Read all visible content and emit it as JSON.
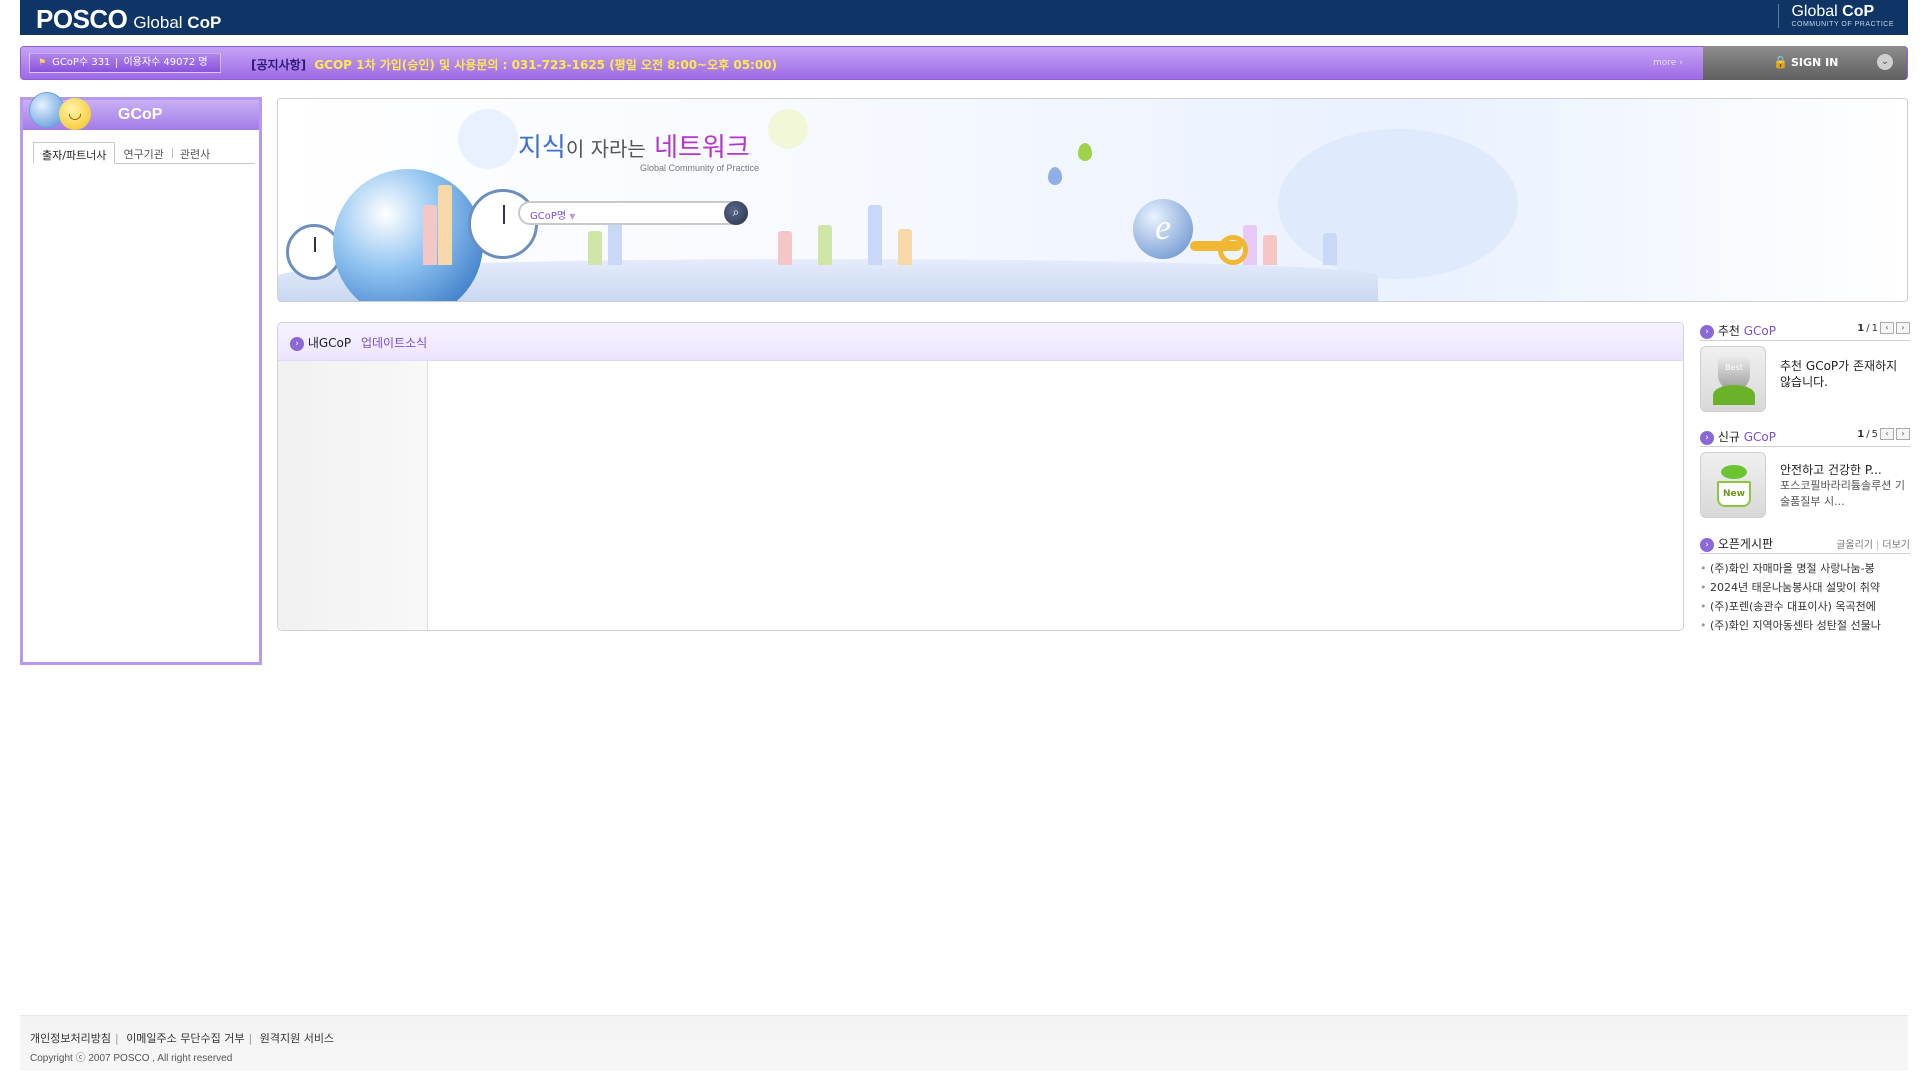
{
  "header": {
    "brand_posco": "POSCO",
    "brand_global": "Global",
    "brand_cop": "CoP",
    "right_global": "Global",
    "right_cop": "CoP",
    "right_sub": "COMMUNITY OF PRACTICE"
  },
  "noticebar": {
    "gcop_count": "GCoP수 331",
    "user_count": "이용자수 49072 명",
    "notice_label": "[공지사항]",
    "notice_text": "GCOP 1차 가입(승인) 및 사용문의 : 031-723-1625 (평일 오전 8:00~오후 05:00)",
    "more": "more",
    "signin": "SIGN IN"
  },
  "left_panel": {
    "title": "GCoP",
    "tabs": [
      "출자/파트너사",
      "연구기관",
      "관련사"
    ]
  },
  "banner": {
    "slogan_1": "지식",
    "slogan_2": "이 자라는",
    "slogan_3": "네트워크",
    "slogan_sub": "Global Community of Practice",
    "search_select": "GCoP명"
  },
  "updates": {
    "title": "내GCoP",
    "title_sub": "업데이트소식"
  },
  "recommended": {
    "title_a": "추천",
    "title_b": "GCoP",
    "page_current": "1",
    "page_total": "1",
    "badge": "Best",
    "text": "추천 GCoP가 존재하지 않습니다."
  },
  "new_gcop": {
    "title_a": "신규",
    "title_b": "GCoP",
    "page_current": "1",
    "page_total": "5",
    "badge": "New",
    "item_title": "안전하고 건강한 P...",
    "item_desc": "포스코필바라리튬솔루션 기술품질부 시..."
  },
  "open_board": {
    "title": "오픈게시판",
    "write": "글올리기",
    "more": "더보기",
    "items": [
      "(주)화인 자매마을 명절 사랑나눔-봉",
      "2024년 태운나눔봉사대 설맞이 취약",
      "(주)포렌(송관수 대표이사) 옥곡천에",
      "(주)화인 지역아동센타 성탄절 선물나"
    ]
  },
  "footer": {
    "links": [
      "개인정보처리방침",
      "이메일주소 무단수집 거부",
      "원격지원 서비스"
    ],
    "copyright": "Copyright ⓒ 2007 POSCO , All right reserved"
  }
}
